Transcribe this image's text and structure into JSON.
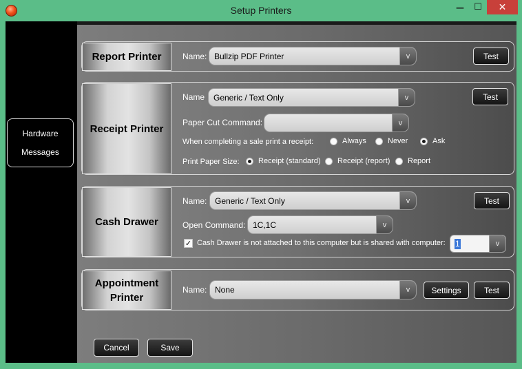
{
  "window": {
    "title": "Setup Printers",
    "minimize_glyph": "—",
    "maximize_glyph": "☐",
    "close_glyph": "✕"
  },
  "sidebar": {
    "hardware_label": "Hardware",
    "messages_label": "Messages"
  },
  "report_printer": {
    "section_label": "Report Printer",
    "name_label": "Name:",
    "name_value": "Bullzip PDF Printer",
    "test_label": "Test"
  },
  "receipt_printer": {
    "section_label": "Receipt Printer",
    "name_label": "Name",
    "name_value": "Generic / Text Only",
    "test_label": "Test",
    "paper_cut_label": "Paper Cut Command:",
    "paper_cut_value": "",
    "sale_print_label": "When completing a sale print a receipt:",
    "sale_print_options": [
      "Always",
      "Never",
      "Ask"
    ],
    "sale_print_selected": "Ask",
    "paper_size_label": "Print Paper Size:",
    "paper_size_options": [
      "Receipt (standard)",
      "Receipt (report)",
      "Report"
    ],
    "paper_size_selected": "Receipt (standard)"
  },
  "cash_drawer": {
    "section_label": "Cash Drawer",
    "name_label": "Name:",
    "name_value": "Generic / Text Only",
    "test_label": "Test",
    "open_command_label": "Open Command:",
    "open_command_value": "1C,1C",
    "shared_label": "Cash Drawer is not attached to this computer but is shared with computer:",
    "shared_checked": true,
    "shared_value": "1"
  },
  "appointment_printer": {
    "section_label": "Appointment Printer",
    "name_label": "Name:",
    "name_value": "None",
    "settings_label": "Settings",
    "test_label": "Test"
  },
  "footer": {
    "cancel_label": "Cancel",
    "save_label": "Save"
  },
  "dropdown_glyph": "v",
  "check_glyph": "✓",
  "colors": {
    "window_frame": "#5bbd88",
    "close_button": "#c8403a",
    "sidebar": "#000000",
    "selection": "#3b78d8"
  }
}
